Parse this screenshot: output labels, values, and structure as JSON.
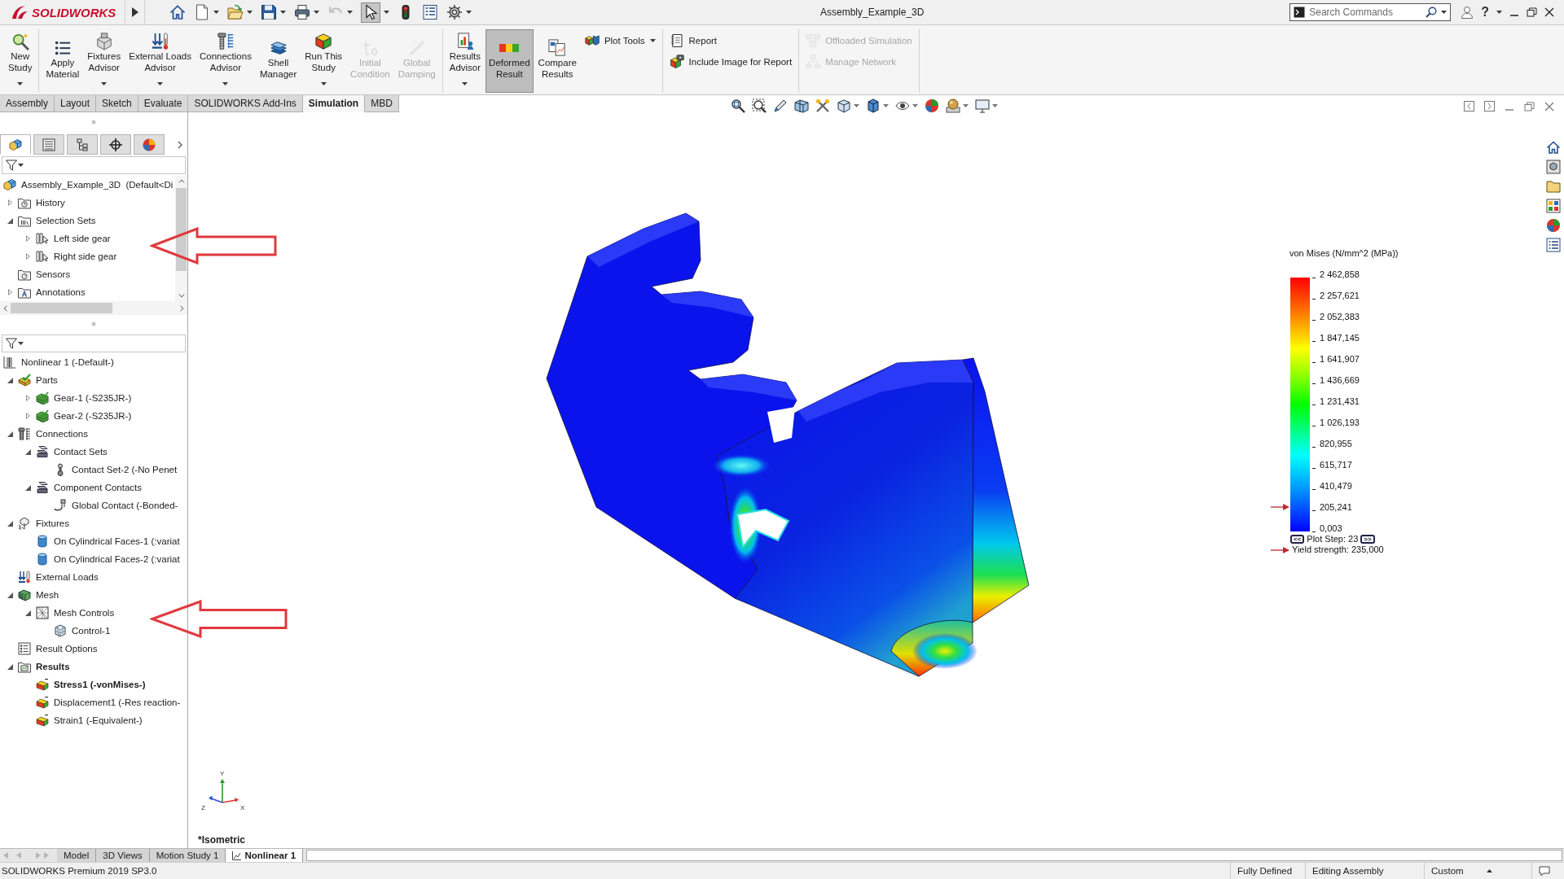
{
  "title_bar": {
    "logo": "SOLIDWORKS",
    "title": "Assembly_Example_3D",
    "search": {
      "placeholder": "Search Commands"
    },
    "help": "?"
  },
  "quick_access": [
    {
      "kind": "home",
      "dropdown": false,
      "disabled": false,
      "pressed": false
    },
    {
      "kind": "new",
      "dropdown": true,
      "disabled": false,
      "pressed": false
    },
    {
      "kind": "open",
      "dropdown": true,
      "disabled": false,
      "pressed": false
    },
    {
      "kind": "save",
      "dropdown": true,
      "disabled": false,
      "pressed": false
    },
    {
      "kind": "print",
      "dropdown": true,
      "disabled": false,
      "pressed": false
    },
    {
      "kind": "undo",
      "dropdown": true,
      "disabled": true,
      "pressed": false
    },
    {
      "kind": "select",
      "dropdown": true,
      "disabled": false,
      "pressed": true
    },
    {
      "kind": "rebuild",
      "dropdown": false,
      "disabled": false,
      "pressed": false
    },
    {
      "kind": "properties",
      "dropdown": false,
      "disabled": false,
      "pressed": false
    },
    {
      "kind": "options",
      "dropdown": true,
      "disabled": false,
      "pressed": false
    }
  ],
  "ribbon": [
    {
      "large": [
        {
          "lines": [
            "New",
            "Study"
          ],
          "kind": "new-study",
          "dropdown": true,
          "disabled": false,
          "pressed": false
        }
      ]
    },
    {
      "large": [
        {
          "lines": [
            "Apply",
            "Material"
          ],
          "kind": "apply-material",
          "dropdown": false,
          "disabled": false,
          "pressed": false
        },
        {
          "lines": [
            "Fixtures",
            "Advisor"
          ],
          "kind": "fixtures",
          "dropdown": true,
          "disabled": false,
          "pressed": false
        },
        {
          "lines": [
            "External Loads",
            "Advisor"
          ],
          "kind": "loads",
          "dropdown": true,
          "disabled": false,
          "pressed": false
        },
        {
          "lines": [
            "Connections",
            "Advisor"
          ],
          "kind": "connections",
          "dropdown": true,
          "disabled": false,
          "pressed": false
        },
        {
          "lines": [
            "Shell",
            "Manager"
          ],
          "kind": "shell",
          "dropdown": false,
          "disabled": false,
          "pressed": false
        },
        {
          "lines": [
            "Run This",
            "Study"
          ],
          "kind": "run",
          "dropdown": true,
          "disabled": false,
          "pressed": false
        },
        {
          "lines": [
            "Initial",
            "Condition"
          ],
          "kind": "initial-condition",
          "dropdown": false,
          "disabled": true,
          "pressed": false
        },
        {
          "lines": [
            "Global",
            "Damping"
          ],
          "kind": "damping",
          "dropdown": false,
          "disabled": true,
          "pressed": false
        }
      ]
    },
    {
      "large": [
        {
          "lines": [
            "Results",
            "Advisor"
          ],
          "kind": "results-advisor",
          "dropdown": true,
          "disabled": false,
          "pressed": false
        },
        {
          "lines": [
            "Deformed",
            "Result"
          ],
          "kind": "deformed",
          "dropdown": false,
          "disabled": false,
          "pressed": true
        },
        {
          "lines": [
            "Compare",
            "Results"
          ],
          "kind": "compare",
          "dropdown": false,
          "disabled": false,
          "pressed": false
        }
      ],
      "small": [
        {
          "label": "Plot Tools",
          "kind": "plot-tools",
          "dropdown": true,
          "disabled": false
        }
      ]
    },
    {
      "small": [
        {
          "label": "Report",
          "kind": "report",
          "dropdown": false,
          "disabled": false
        },
        {
          "label": "Include Image for Report",
          "kind": "include-image",
          "dropdown": false,
          "disabled": false
        }
      ]
    },
    {
      "small": [
        {
          "label": "Offloaded Simulation",
          "kind": "offload",
          "dropdown": false,
          "disabled": true
        },
        {
          "label": "Manage Network",
          "kind": "network",
          "dropdown": false,
          "disabled": true
        }
      ]
    }
  ],
  "tabs": [
    {
      "label": "Assembly",
      "selected": false
    },
    {
      "label": "Layout",
      "selected": false
    },
    {
      "label": "Sketch",
      "selected": false
    },
    {
      "label": "Evaluate",
      "selected": false
    },
    {
      "label": "SOLIDWORKS Add-Ins",
      "selected": false
    },
    {
      "label": "Simulation",
      "selected": true
    },
    {
      "label": "MBD",
      "selected": false
    }
  ],
  "panel_tabs": [
    {
      "selected": true
    },
    {
      "selected": false
    },
    {
      "selected": false
    },
    {
      "selected": false
    },
    {
      "selected": false
    }
  ],
  "feature_tree": {
    "root": {
      "label": "Assembly_Example_3D  (Default<Di",
      "kind": "assembly",
      "children": [
        {
          "label": "History",
          "kind": "history",
          "expanded": false
        },
        {
          "label": "Selection Sets",
          "kind": "selection-sets",
          "expanded": true,
          "children": [
            {
              "label": "Left side gear",
              "kind": "selection-set",
              "expanded": false
            },
            {
              "label": "Right side gear",
              "kind": "selection-set",
              "expanded": false
            }
          ]
        },
        {
          "label": "Sensors",
          "kind": "sensors"
        },
        {
          "label": "Annotations",
          "kind": "annotations",
          "expanded": false
        }
      ]
    }
  },
  "sim_tree": {
    "root": {
      "label": "Nonlinear 1 (-Default-)",
      "kind": "study",
      "active": false,
      "children": [
        {
          "label": "Parts",
          "kind": "parts",
          "expanded": true,
          "active": false,
          "children": [
            {
              "label": "Gear-1 (-S235JR-)",
              "kind": "part",
              "expanded": false,
              "active": false
            },
            {
              "label": "Gear-2 (-S235JR-)",
              "kind": "part",
              "expanded": false,
              "active": false
            }
          ]
        },
        {
          "label": "Connections",
          "kind": "connections",
          "expanded": true,
          "active": false,
          "children": [
            {
              "label": "Contact Sets",
              "kind": "contact-sets",
              "expanded": true,
              "active": false,
              "children": [
                {
                  "label": "Contact Set-2 (-No Penet",
                  "kind": "contact-set",
                  "active": false
                }
              ]
            },
            {
              "label": "Component Contacts",
              "kind": "component-contacts",
              "expanded": true,
              "active": false,
              "children": [
                {
                  "label": "Global Contact (-Bonded-",
                  "kind": "global-contact",
                  "active": false
                }
              ]
            }
          ]
        },
        {
          "label": "Fixtures",
          "kind": "fixtures",
          "expanded": true,
          "active": false,
          "children": [
            {
              "label": "On Cylindrical Faces-1 (:variat",
              "kind": "fixture",
              "active": false
            },
            {
              "label": "On Cylindrical Faces-2 (:variat",
              "kind": "fixture",
              "active": false
            }
          ]
        },
        {
          "label": "External Loads",
          "kind": "external-loads",
          "active": false
        },
        {
          "label": "Mesh",
          "kind": "mesh",
          "expanded": true,
          "active": false,
          "children": [
            {
              "label": "Mesh Controls",
              "kind": "mesh-controls",
              "expanded": true,
              "active": false,
              "children": [
                {
                  "label": "Control-1",
                  "kind": "mesh-control",
                  "active": false
                }
              ]
            }
          ]
        },
        {
          "label": "Result Options",
          "kind": "result-options",
          "active": false
        },
        {
          "label": "Results",
          "kind": "results",
          "expanded": true,
          "active": true,
          "children": [
            {
              "label": "Stress1 (-vonMises-)",
              "kind": "stress",
              "active": true
            },
            {
              "label": "Displacement1 (-Res reaction-",
              "kind": "displacement",
              "active": false
            },
            {
              "label": "Strain1 (-Equivalent-)",
              "kind": "strain",
              "active": false
            }
          ]
        }
      ]
    }
  },
  "viewport": {
    "legend": {
      "title": "von Mises (N/mm^2 (MPa))",
      "values": [
        "2 462,858",
        "2 257,621",
        "2 052,383",
        "1 847,145",
        "1 641,907",
        "1 436,669",
        "1 231,431",
        "1 026,193",
        "820,955",
        "615,717",
        "410,479",
        "205,241",
        "0,003"
      ],
      "prev": "<<",
      "plot_step": "Plot Step: 23",
      "next": ">>",
      "yield_strength": "Yield strength: 235,000"
    },
    "triad_axes": [
      "Y",
      "Z",
      "X"
    ],
    "view_name": "*Isometric"
  },
  "bottom_tabs": [
    {
      "label": "Model",
      "kind": "plain",
      "selected": false
    },
    {
      "label": "3D Views",
      "kind": "plain",
      "selected": false
    },
    {
      "label": "Motion Study 1",
      "kind": "plain",
      "selected": false
    },
    {
      "label": "Nonlinear 1",
      "kind": "study",
      "selected": true
    }
  ],
  "status_bar": {
    "product": "SOLIDWORKS Premium 2019 SP3.0",
    "state": "Fully Defined",
    "mode": "Editing Assembly",
    "units": "Custom"
  }
}
